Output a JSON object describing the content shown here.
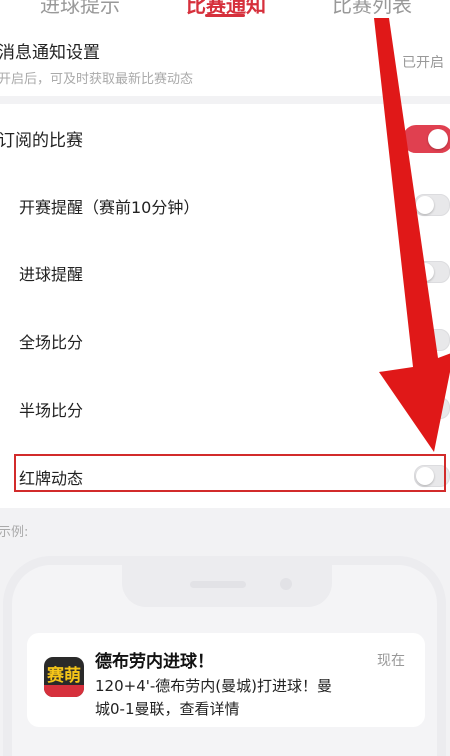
{
  "tabs": [
    {
      "label": "进球提示",
      "active": false
    },
    {
      "label": "比赛通知",
      "active": true
    },
    {
      "label": "比赛列表",
      "active": false
    }
  ],
  "notify_settings": {
    "title": "消息通知设置",
    "subtitle": "开启后，可及时获取最新比赛动态",
    "state": "已开启"
  },
  "subscription": {
    "label": "订阅的比赛",
    "enabled": true
  },
  "options": [
    {
      "label": "开赛提醒（赛前10分钟）",
      "enabled": false
    },
    {
      "label": "进球提醒",
      "enabled": false
    },
    {
      "label": "全场比分",
      "enabled": false
    },
    {
      "label": "半场比分",
      "enabled": false
    },
    {
      "label": "红牌动态",
      "enabled": false
    }
  ],
  "example": {
    "label": "示例:",
    "notification": {
      "app_icon": "app-logo-icon",
      "logo_text": "赛萌",
      "title": "德布劳内进球！",
      "time": "现在",
      "body": "120+4'-德布劳内(曼城)打进球！曼城0-1曼联，查看详情"
    }
  },
  "colors": {
    "accent": "#d6303c",
    "toggle_on": "#e04050",
    "annotation": "#e01818"
  }
}
